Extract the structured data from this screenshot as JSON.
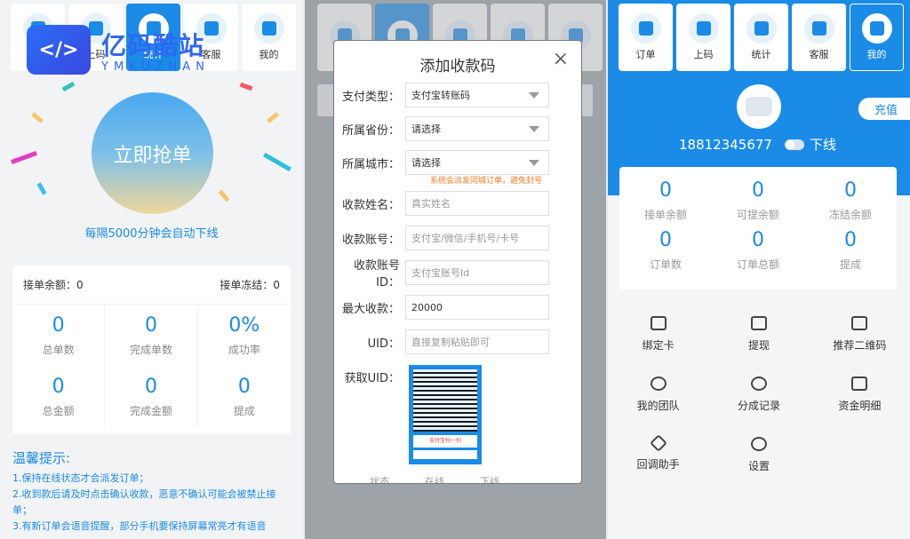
{
  "tabs": [
    "订单",
    "上码",
    "统计",
    "客服",
    "我的"
  ],
  "left": {
    "logo_cn": "亿码酷站",
    "logo_en": "YMKUZHAN",
    "grab_button": "立即抢单",
    "offline_notice": "每隔5000分钟会自动下线",
    "balance_label": "接单余额：",
    "balance_value": "0",
    "frozen_label": "接单冻结：",
    "frozen_value": "0",
    "stats": [
      {
        "value": "0",
        "label": "总单数"
      },
      {
        "value": "0",
        "label": "完成单数"
      },
      {
        "value": "0%",
        "label": "成功率"
      },
      {
        "value": "0",
        "label": "总金额"
      },
      {
        "value": "0",
        "label": "完成金额"
      },
      {
        "value": "0",
        "label": "提成"
      }
    ],
    "tips_title": "温馨提示:",
    "tips": [
      "1.保持在线状态才会派发订单；",
      "2.收到款后请及时点击确认收款，恶意不确认可能会被禁止接单；",
      "3.有新订单会语音提醒，部分手机要保持屏幕常亮才有语音"
    ]
  },
  "modal": {
    "title": "添加收款码",
    "close": "×",
    "pay_type_label": "支付类型：",
    "pay_type_value": "支付宝转账码",
    "province_label": "所属省份：",
    "province_value": "请选择",
    "city_label": "所属城市：",
    "city_value": "请选择",
    "city_warning": "系统会派发同城订单，避免封号",
    "name_label": "收款姓名：",
    "name_placeholder": "真实姓名",
    "account_label": "收款账号：",
    "account_placeholder": "支付宝/微信/手机号/卡号",
    "account_id_label": "收款账号ID：",
    "account_id_placeholder": "支付宝账号Id",
    "max_label": "最大收款：",
    "max_value": "20000",
    "uid_label": "UID：",
    "uid_placeholder": "直接复制粘贴即可",
    "get_uid_label": "获取UID：",
    "qr_caption": "支付宝扫一扫",
    "footer_status_label": "状态",
    "footer_online": "在线",
    "footer_offline": "下线"
  },
  "right": {
    "recharge": "充值",
    "phone": "18812345677",
    "status": "下线",
    "stats": [
      {
        "value": "0",
        "label": "接单余额"
      },
      {
        "value": "0",
        "label": "可提余额"
      },
      {
        "value": "0",
        "label": "冻结余额"
      },
      {
        "value": "0",
        "label": "订单数"
      },
      {
        "value": "0",
        "label": "订单总额"
      },
      {
        "value": "0",
        "label": "提成"
      }
    ],
    "menu": [
      {
        "label": "绑定卡",
        "icon": "card-icon"
      },
      {
        "label": "提现",
        "icon": "withdraw-icon"
      },
      {
        "label": "推荐二维码",
        "icon": "qrcode-icon"
      },
      {
        "label": "我的团队",
        "icon": "team-icon"
      },
      {
        "label": "分成记录",
        "icon": "pie-icon"
      },
      {
        "label": "资金明细",
        "icon": "wallet-icon"
      },
      {
        "label": "回调助手",
        "icon": "send-icon"
      },
      {
        "label": "设置",
        "icon": "settings-icon"
      }
    ]
  },
  "colors": {
    "accent": "#1a8be6",
    "warning": "#f07a1c"
  }
}
